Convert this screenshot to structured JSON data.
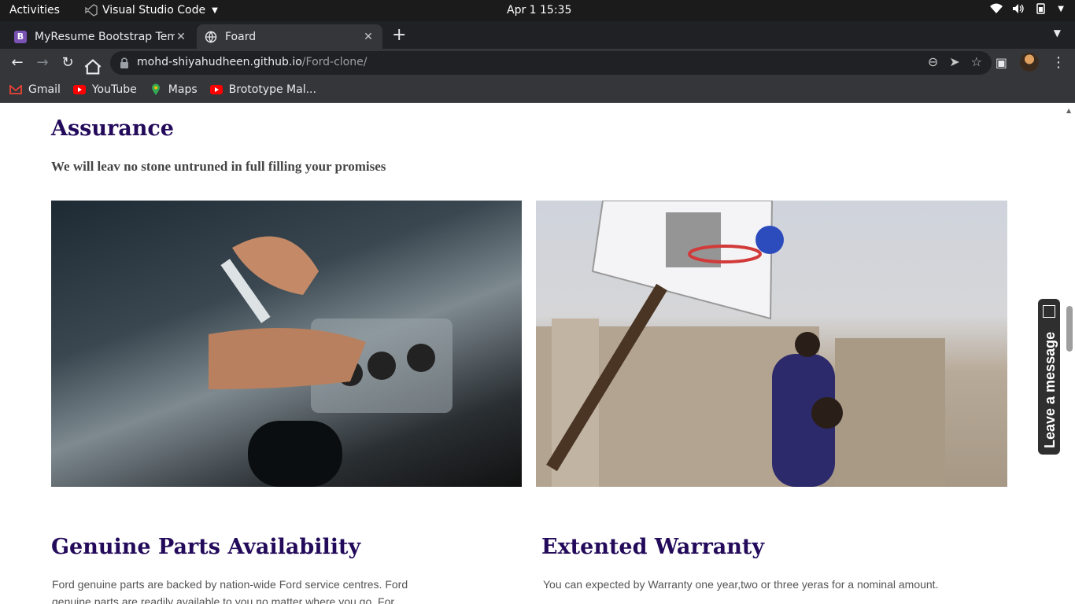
{
  "system_bar": {
    "activities": "Activities",
    "app_name": "Visual Studio Code",
    "clock": "Apr 1  15:35"
  },
  "tabs": [
    {
      "title": "MyResume Bootstrap Template",
      "favicon": "B",
      "favicon_color": "#7952b3"
    },
    {
      "title": "Foard",
      "favicon": "globe-icon"
    }
  ],
  "address_bar": {
    "domain": "mohd-shiyahudheen.github.io",
    "path": "/Ford-clone/"
  },
  "bookmarks": [
    {
      "label": "Gmail",
      "icon": "gmail-icon"
    },
    {
      "label": "YouTube",
      "icon": "youtube-icon"
    },
    {
      "label": "Maps",
      "icon": "maps-icon"
    },
    {
      "label": "Brototype Mal...",
      "icon": "youtube-icon"
    }
  ],
  "page": {
    "assurance_title": "Assurance",
    "assurance_subtitle": "We will leav no stone untruned in full filling your promises",
    "images": [
      {
        "alt": "engine-repair-photo"
      },
      {
        "alt": "basketball-photo"
      }
    ],
    "parts_title": "Genuine Parts Availability",
    "parts_text": "Ford genuine parts are backed by nation-wide Ford service centres. Ford genuine parts are readily available to you no matter where you go. For",
    "warranty_title": "Extented Warranty",
    "warranty_text": "You can expected by Warranty one year,two or three yeras for a nominal amount."
  },
  "chat_widget": {
    "label": "Leave a message"
  },
  "colors": {
    "heading": "#230a5a",
    "chrome_dark": "#202124",
    "chrome_toolbar": "#35363a"
  }
}
